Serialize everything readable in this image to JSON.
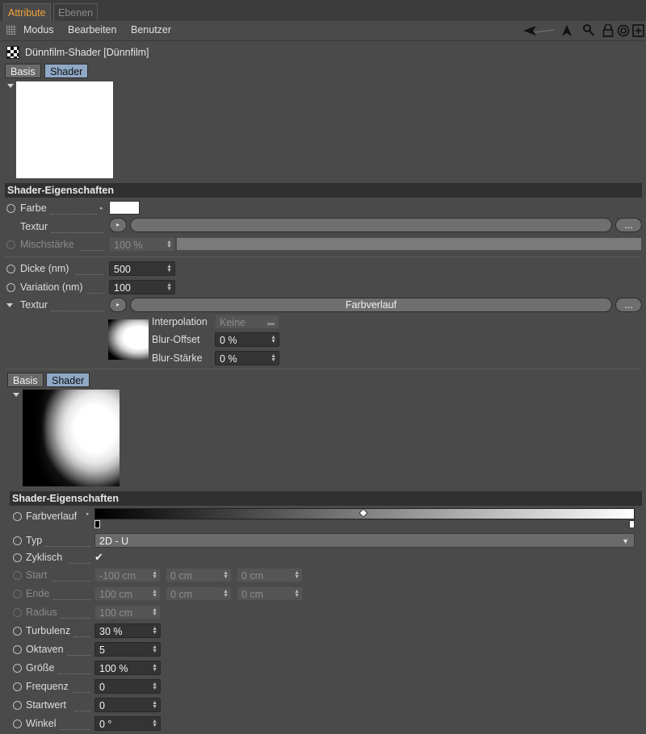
{
  "tabs": [
    {
      "label": "Attribute"
    },
    {
      "label": "Ebenen"
    }
  ],
  "menu": {
    "modus": "Modus",
    "bearbeiten": "Bearbeiten",
    "benutzer": "Benutzer"
  },
  "object_title": "Dünnfilm-Shader [Dünnfilm]",
  "top_subtabs": {
    "basis": "Basis",
    "shader": "Shader"
  },
  "section1": {
    "title": "Shader-Eigenschaften",
    "farbe": {
      "label": "Farbe",
      "color": "#ffffff"
    },
    "textur": {
      "label": "Textur",
      "more": "..."
    },
    "mischstaerke": {
      "label": "Mischstärke",
      "value": "100 %",
      "fill": 1.0
    },
    "dicke": {
      "label": "Dicke (nm)",
      "value": "500"
    },
    "variation": {
      "label": "Variation (nm)",
      "value": "100"
    },
    "textur2": {
      "label": "Textur",
      "shader_name": "Farbverlauf",
      "more": "..."
    },
    "interpolation": {
      "label": "Interpolation",
      "value": "Keine"
    },
    "blur_offset": {
      "label": "Blur-Offset",
      "value": "0 %"
    },
    "blur_staerke": {
      "label": "Blur-Stärke",
      "value": "0 %"
    }
  },
  "inner_subtabs": {
    "basis": "Basis",
    "shader": "Shader"
  },
  "section2": {
    "title": "Shader-Eigenschaften",
    "farbverlauf": {
      "label": "Farbverlauf",
      "start": "#000000",
      "end": "#ffffff"
    },
    "typ": {
      "label": "Typ",
      "value": "2D - U"
    },
    "zyklisch": {
      "label": "Zyklisch",
      "check": "✔"
    },
    "start": {
      "label": "Start",
      "values": [
        "-100 cm",
        "0 cm",
        "0 cm"
      ]
    },
    "ende": {
      "label": "Ende",
      "values": [
        "100 cm",
        "0 cm",
        "0 cm"
      ]
    },
    "radius": {
      "label": "Radius",
      "value": "100 cm"
    },
    "turbulenz": {
      "label": "Turbulenz",
      "value": "30 %"
    },
    "oktaven": {
      "label": "Oktaven",
      "value": "5"
    },
    "groesse": {
      "label": "Größe",
      "value": "100 %"
    },
    "frequenz": {
      "label": "Frequenz",
      "value": "0"
    },
    "startwert": {
      "label": "Startwert",
      "value": "0"
    },
    "winkel": {
      "label": "Winkel",
      "value": "0 °"
    }
  }
}
